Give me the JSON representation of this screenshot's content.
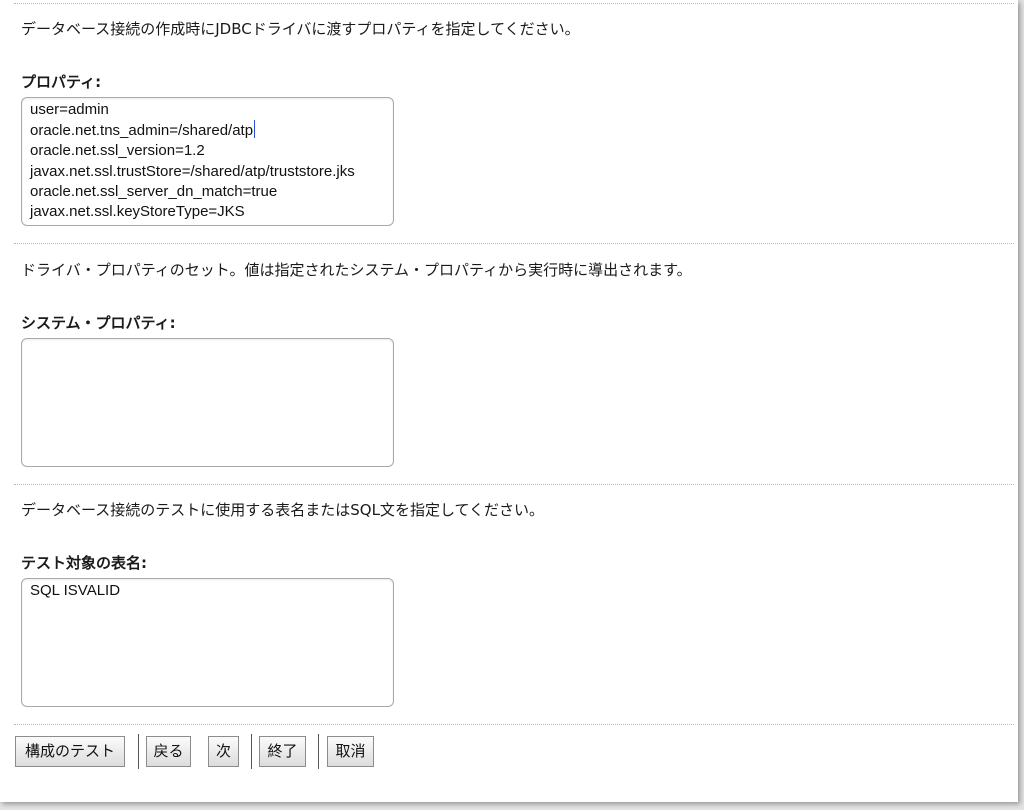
{
  "sections": {
    "jdbc_properties": {
      "description": "データベース接続の作成時にJDBCドライバに渡すプロパティを指定してください。",
      "label": "プロパティ:",
      "lines": [
        "user=admin",
        "oracle.net.tns_admin=/shared/atp",
        "oracle.net.ssl_version=1.2",
        "javax.net.ssl.trustStore=/shared/atp/truststore.jks",
        "oracle.net.ssl_server_dn_match=true",
        "javax.net.ssl.keyStoreType=JKS"
      ]
    },
    "system_properties": {
      "description": "ドライバ・プロパティのセット。値は指定されたシステム・プロパティから実行時に導出されます。",
      "label": "システム・プロパティ:",
      "value": ""
    },
    "test_table": {
      "description": "データベース接続のテストに使用する表名またはSQL文を指定してください。",
      "label": "テスト対象の表名:",
      "value": "SQL ISVALID"
    }
  },
  "buttons": {
    "test_configuration": "構成のテスト",
    "back": "戻る",
    "next": "次",
    "finish": "終了",
    "cancel": "取消"
  },
  "colors": {
    "caret": "#2b4fd6",
    "separator": "#b8b8b8",
    "button_border": "#8c8c8c"
  }
}
